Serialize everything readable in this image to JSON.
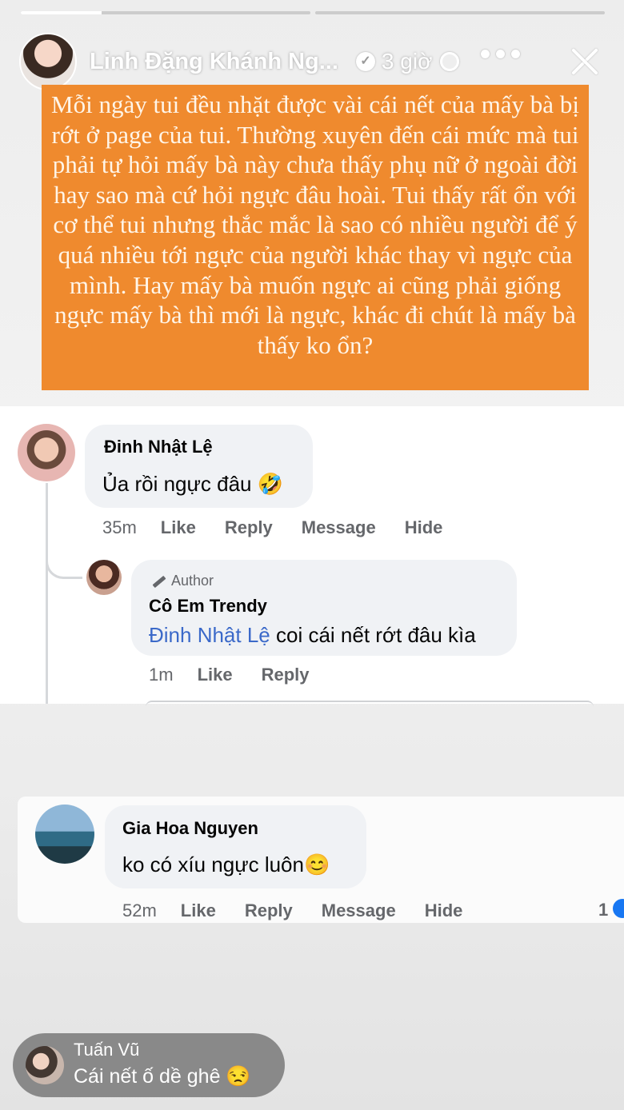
{
  "story": {
    "progress": [
      1.0,
      0.0,
      0.0
    ],
    "author_name": "Linh Đặng Khánh Ng...",
    "time": "3 giờ",
    "icons": [
      "verified-icon",
      "globe-icon",
      "more-icon",
      "close-icon"
    ]
  },
  "post_text": "Mỗi ngày tui đều nhặt được vài cái nết của mấy bà bị rớt ở page của tui. Thường xuyên đến cái mức mà tui phải tự hỏi mấy bà này chưa thấy phụ nữ ở ngoài đời hay sao mà cứ hỏi ngực đâu hoài. Tui thấy rất ổn với cơ thể tui nhưng thắc mắc là sao có nhiều người để ý quá nhiều tới ngực của người khác thay vì ngực của mình. Hay mấy bà muốn ngực ai cũng phải giống ngực mấy bà thì mới là ngực, khác đi chút là mấy bà thấy ko ổn?",
  "comments": [
    {
      "name": "Đinh Nhật Lệ",
      "text": "Ủa rồi ngực đâu 🤣",
      "time": "35m",
      "actions": [
        "Like",
        "Reply",
        "Message",
        "Hide"
      ]
    },
    {
      "badge": "Author",
      "name": "Cô Em Trendy",
      "mention": "Đinh Nhật Lệ",
      "text": "coi cái nết rớt đâu kìa",
      "time": "1m",
      "actions": [
        "Like",
        "Reply"
      ]
    },
    {
      "name": "Gia Hoa Nguyen",
      "text": "ko có xíu ngực luôn😊",
      "time": "52m",
      "actions": [
        "Like",
        "Reply",
        "Message",
        "Hide"
      ],
      "reaction_count": "1"
    }
  ],
  "reply": {
    "name": "Tuấn Vũ",
    "text": "Cái nết ố dề ghê 😒"
  }
}
